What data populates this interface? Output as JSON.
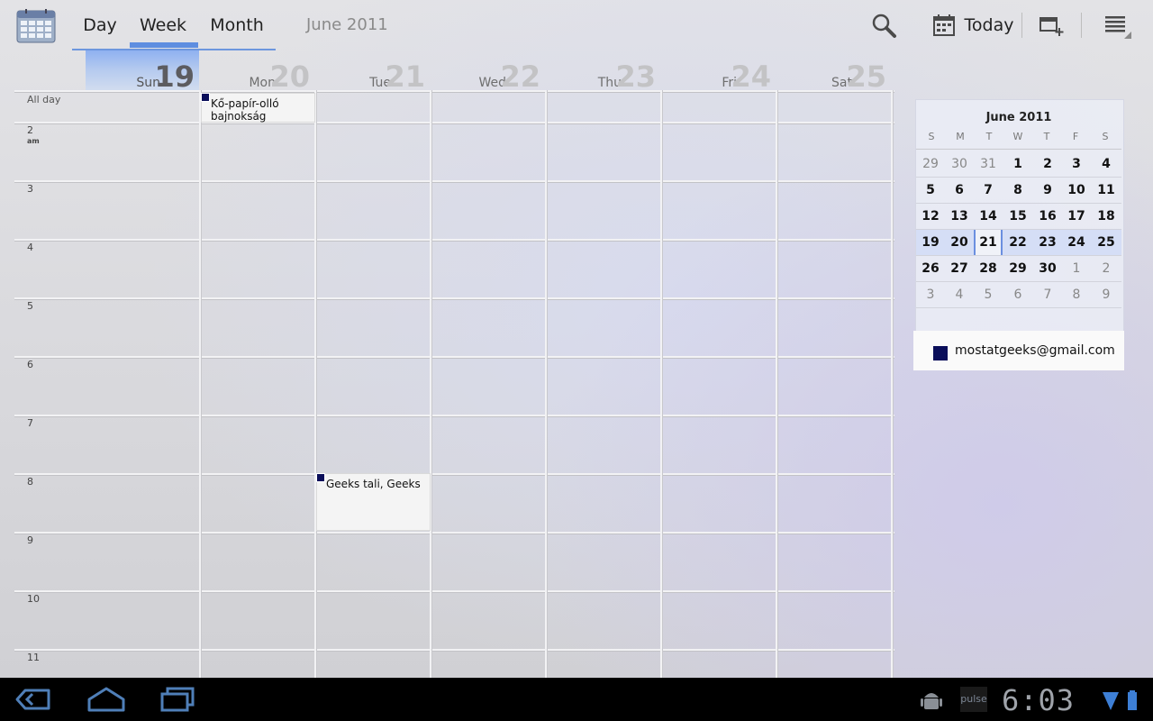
{
  "actionbar": {
    "tabs": [
      {
        "label": "Day"
      },
      {
        "label": "Week"
      },
      {
        "label": "Month"
      }
    ],
    "selected_tab": "Week",
    "month_label": "June 2011",
    "today_label": "Today"
  },
  "week": {
    "days": [
      {
        "name": "Sun",
        "num": "19"
      },
      {
        "name": "Mon",
        "num": "20"
      },
      {
        "name": "Tue",
        "num": "21"
      },
      {
        "name": "Wed",
        "num": "22"
      },
      {
        "name": "Thu",
        "num": "23"
      },
      {
        "name": "Fri",
        "num": "24"
      },
      {
        "name": "Sat",
        "num": "25"
      }
    ],
    "allday_label": "All day",
    "hours": [
      {
        "label": "2",
        "ampm": "am"
      },
      {
        "label": "3",
        "ampm": ""
      },
      {
        "label": "4",
        "ampm": ""
      },
      {
        "label": "5",
        "ampm": ""
      },
      {
        "label": "6",
        "ampm": ""
      },
      {
        "label": "7",
        "ampm": ""
      },
      {
        "label": "8",
        "ampm": ""
      },
      {
        "label": "9",
        "ampm": ""
      },
      {
        "label": "10",
        "ampm": ""
      },
      {
        "label": "11",
        "ampm": ""
      }
    ],
    "events": {
      "allday": {
        "title": "Kő-papír-olló bajnokság",
        "day": "Mon"
      },
      "timed": {
        "title": "Geeks tali, Geeks",
        "day": "Tue",
        "start_hour": "8"
      }
    },
    "event_color": "#0a0e5a"
  },
  "minical": {
    "title": "June 2011",
    "dow": [
      "S",
      "M",
      "T",
      "W",
      "T",
      "F",
      "S"
    ],
    "weeks": [
      [
        "29",
        "30",
        "31",
        "1",
        "2",
        "3",
        "4"
      ],
      [
        "5",
        "6",
        "7",
        "8",
        "9",
        "10",
        "11"
      ],
      [
        "12",
        "13",
        "14",
        "15",
        "16",
        "17",
        "18"
      ],
      [
        "19",
        "20",
        "21",
        "22",
        "23",
        "24",
        "25"
      ],
      [
        "26",
        "27",
        "28",
        "29",
        "30",
        "1",
        "2"
      ],
      [
        "3",
        "4",
        "5",
        "6",
        "7",
        "8",
        "9"
      ]
    ],
    "selected_week_index": 3,
    "today": "21"
  },
  "account": {
    "email": "mostatgeeks@gmail.com",
    "color": "#0a0e5a"
  },
  "systembar": {
    "clock": "6:03",
    "pulse_label": "pulse"
  }
}
